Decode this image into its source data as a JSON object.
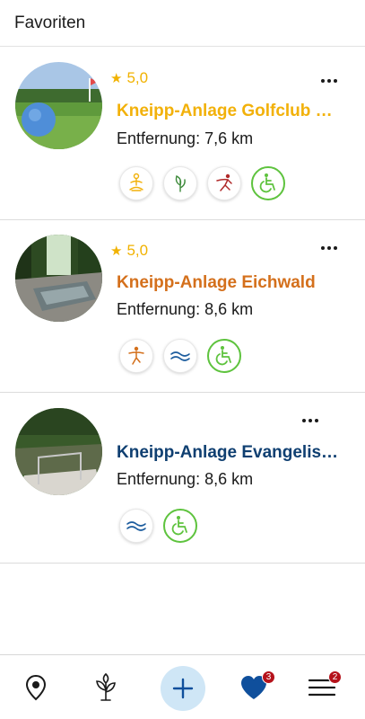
{
  "header": {
    "title": "Favoriten"
  },
  "colors": {
    "rating": "#f1b200",
    "accessible": "#5ec33e",
    "nav_add_bg": "#cfe6f6",
    "heart": "#0f4f9c",
    "badge": "#b5121b"
  },
  "favorites": [
    {
      "rating": "5,0",
      "name": "Kneipp-Anlage Golfclub Bad Wörishofen",
      "name_color": "#f2b10a",
      "distance": "Entfernung: 7,6 km",
      "amenities": [
        "yoga-icon",
        "plant-icon",
        "movement-icon",
        "wheelchair-icon"
      ]
    },
    {
      "rating": "5,0",
      "name": "Kneipp-Anlage Eichwald",
      "name_color": "#d4701c",
      "distance": "Entfernung: 8,6 km",
      "amenities": [
        "movement-icon",
        "water-icon",
        "wheelchair-icon"
      ]
    },
    {
      "rating": "",
      "name": "Kneipp-Anlage Evangelische Gemeinde",
      "name_color": "#0f3f71",
      "distance": "Entfernung: 8,6 km",
      "amenities": [
        "water-icon",
        "wheelchair-icon"
      ]
    }
  ],
  "nav": {
    "items": [
      "map-pin-icon",
      "plant-icon",
      "add-icon",
      "heart-icon",
      "menu-icon"
    ],
    "favorites_badge": "3",
    "menu_badge": "2"
  }
}
